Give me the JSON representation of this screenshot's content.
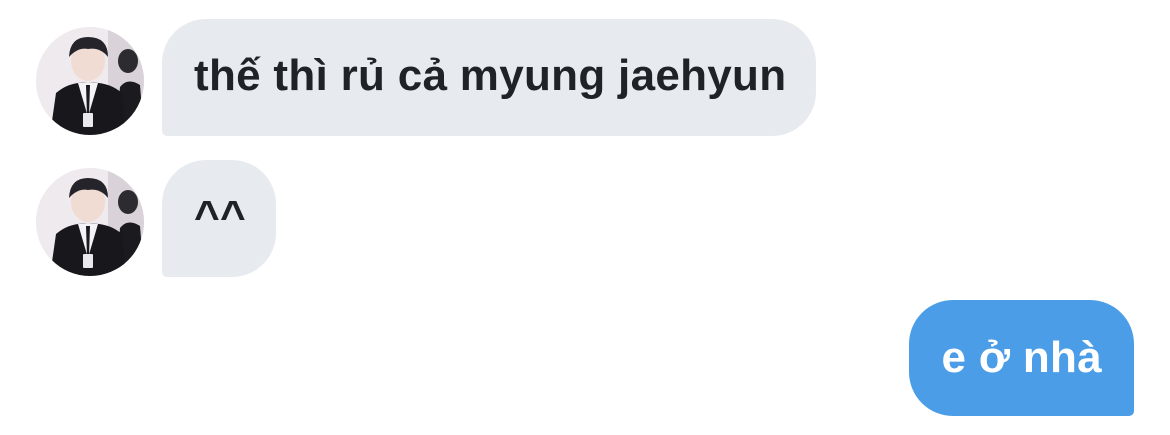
{
  "conversation": {
    "messages": [
      {
        "sender": "incoming",
        "text": "thế thì rủ cả myung jaehyun",
        "avatar_icon": "user-avatar-icon"
      },
      {
        "sender": "incoming",
        "text": "^^",
        "avatar_icon": "user-avatar-icon"
      },
      {
        "sender": "outgoing",
        "text": "e ở nhà"
      }
    ]
  },
  "colors": {
    "incoming_bubble": "#e7ebef",
    "incoming_text": "#1f2328",
    "outgoing_bubble": "#4a9de6",
    "outgoing_text": "#ffffff",
    "background": "#ffffff"
  }
}
